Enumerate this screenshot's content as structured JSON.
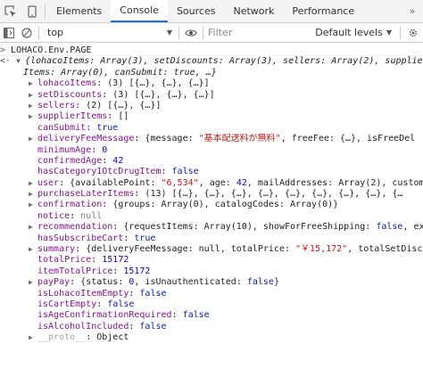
{
  "tabs": [
    "Elements",
    "Console",
    "Sources",
    "Network",
    "Performance"
  ],
  "toolbar": {
    "context": "top",
    "filter_placeholder": "Filter",
    "levels": "Default levels"
  },
  "command": "LOHACO.Env.PAGE",
  "summary_line1": "{lohacoItems: Array(3), setDiscounts: Array(3), sellers: Array(2), supplier",
  "summary_line2": "Items: Array(0), canSubmit: true, …}",
  "props": [
    {
      "k": "lohacoItems",
      "v": "(3) [{…}, {…}, {…}]",
      "exp": true
    },
    {
      "k": "setDiscounts",
      "v": "(3) [{…}, {…}, {…}]",
      "exp": true
    },
    {
      "k": "sellers",
      "v": "(2) [{…}, {…}]",
      "exp": true
    },
    {
      "k": "supplierItems",
      "v": "[]",
      "exp": true
    },
    {
      "k": "canSubmit",
      "v": "true",
      "t": "b",
      "exp": false
    },
    {
      "k": "deliveryFeeMessage",
      "exp": true,
      "parts": [
        [
          "{message: ",
          ""
        ],
        [
          "\"基本配送料が無料\"",
          "s"
        ],
        [
          ", freeFee: {…}, isFreeDel",
          ""
        ]
      ]
    },
    {
      "k": "minimumAge",
      "v": "0",
      "t": "n",
      "exp": false
    },
    {
      "k": "confirmedAge",
      "v": "42",
      "t": "n",
      "exp": false
    },
    {
      "k": "hasCategory1OtcDrugItem",
      "v": "false",
      "t": "b",
      "exp": false
    },
    {
      "k": "user",
      "exp": true,
      "parts": [
        [
          "{availablePoint: ",
          ""
        ],
        [
          "\"6,534\"",
          "s"
        ],
        [
          ", age: ",
          ""
        ],
        [
          "42",
          "n"
        ],
        [
          ", mailAddresses: Array(2), custom",
          ""
        ]
      ]
    },
    {
      "k": "purchaseLaterItems",
      "v": "(13) [{…}, {…}, {…}, {…}, {…}, {…}, {…}, {…}, {…",
      "exp": true
    },
    {
      "k": "confirmation",
      "v": "{groups: Array(0), catalogCodes: Array(0)}",
      "exp": true
    },
    {
      "k": "notice",
      "v": "null",
      "t": "null",
      "exp": false
    },
    {
      "k": "recommendation",
      "exp": true,
      "parts": [
        [
          "{requestItems: Array(10), showForFreeShipping: ",
          ""
        ],
        [
          "false",
          "b"
        ],
        [
          ", ex",
          ""
        ]
      ]
    },
    {
      "k": "hasSubscribeCart",
      "v": "true",
      "t": "b",
      "exp": false
    },
    {
      "k": "summary",
      "exp": true,
      "parts": [
        [
          "{deliveryFeeMessage: null, totalPrice: ",
          ""
        ],
        [
          "\"￥15,172\"",
          "s"
        ],
        [
          ", totalSetDisc",
          ""
        ]
      ]
    },
    {
      "k": "totalPrice",
      "v": "15172",
      "t": "n",
      "exp": false
    },
    {
      "k": "itemTotalPrice",
      "v": "15172",
      "t": "n",
      "exp": false
    },
    {
      "k": "payPay",
      "exp": true,
      "parts": [
        [
          "{status: ",
          ""
        ],
        [
          "0",
          "n"
        ],
        [
          ", isUnauthenticated: ",
          ""
        ],
        [
          "false",
          "b"
        ],
        [
          "}",
          ""
        ]
      ]
    },
    {
      "k": "isLohacoItemEmpty",
      "v": "false",
      "t": "b",
      "exp": false
    },
    {
      "k": "isCartEmpty",
      "v": "false",
      "t": "b",
      "exp": false
    },
    {
      "k": "isAgeConfirmationRequired",
      "v": "false",
      "t": "b",
      "exp": false
    },
    {
      "k": "isAlcoholIncluded",
      "v": "false",
      "t": "b",
      "exp": false
    },
    {
      "k": "__proto__",
      "v": "Object",
      "exp": true,
      "proto": true
    }
  ]
}
